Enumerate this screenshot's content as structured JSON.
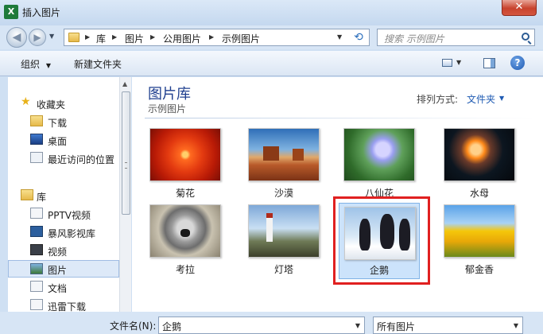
{
  "window": {
    "title": "插入图片",
    "app_icon": "X",
    "close_label": "✕"
  },
  "nav": {
    "breadcrumbs": [
      "库",
      "图片",
      "公用图片",
      "示例图片"
    ],
    "search_placeholder": "搜索 示例图片"
  },
  "toolbar": {
    "organize_label": "组织",
    "new_folder_label": "新建文件夹"
  },
  "sidebar": {
    "favorites_header": "收藏夹",
    "favorites": [
      "下载",
      "桌面",
      "最近访问的位置"
    ],
    "libraries_header": "库",
    "libraries": [
      "PPTV视频",
      "暴风影视库",
      "视频",
      "图片",
      "文档",
      "迅雷下载"
    ],
    "selected": "图片"
  },
  "main": {
    "library_title": "图片库",
    "library_subtitle": "示例图片",
    "arrange_label": "排列方式:",
    "arrange_value": "文件夹",
    "images": [
      {
        "name": "菊花",
        "art": "chrysanthemum"
      },
      {
        "name": "沙漠",
        "art": "desert"
      },
      {
        "name": "八仙花",
        "art": "hydrangeas"
      },
      {
        "name": "水母",
        "art": "jellyfish"
      },
      {
        "name": "考拉",
        "art": "koala"
      },
      {
        "name": "灯塔",
        "art": "lighthouse"
      },
      {
        "name": "企鹅",
        "art": "penguins",
        "selected": true
      },
      {
        "name": "郁金香",
        "art": "tulips"
      }
    ]
  },
  "bottom": {
    "filename_label": "文件名(N):",
    "filename_value": "企鹅",
    "filetype_value": "所有图片"
  },
  "colors": {
    "accent": "#1f5bb3",
    "highlight": "#e02020",
    "selection": "#cce3fb"
  }
}
